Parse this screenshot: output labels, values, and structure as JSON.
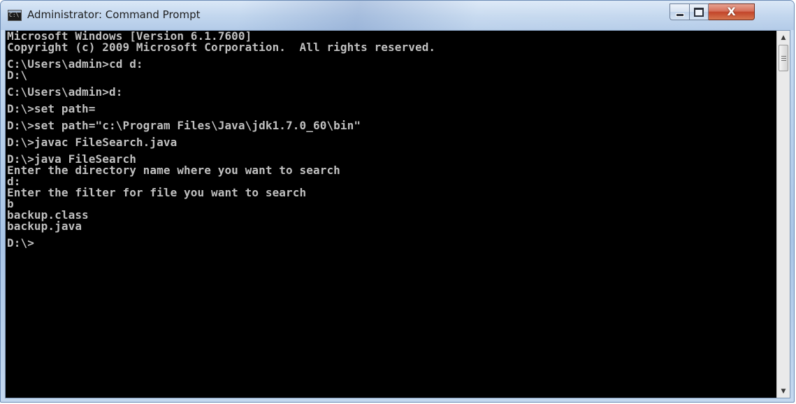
{
  "window": {
    "title": "Administrator: Command Prompt",
    "app_icon_text": "C:\\"
  },
  "controls": {
    "minimize_icon": "minimize-icon",
    "maximize_icon": "maximize-icon",
    "close_icon": "close-icon",
    "close_glyph": "X",
    "close_color": "#c7452a"
  },
  "console": {
    "background_color": "#000000",
    "text_color": "#c0c0c0",
    "lines": [
      "Microsoft Windows [Version 6.1.7600]",
      "Copyright (c) 2009 Microsoft Corporation.  All rights reserved.",
      "",
      "C:\\Users\\admin>cd d:",
      "D:\\",
      "",
      "C:\\Users\\admin>d:",
      "",
      "D:\\>set path=",
      "",
      "D:\\>set path=\"c:\\Program Files\\Java\\jdk1.7.0_60\\bin\"",
      "",
      "D:\\>javac FileSearch.java",
      "",
      "D:\\>java FileSearch",
      "Enter the directory name where you want to search",
      "d:",
      "Enter the filter for file you want to search",
      "b",
      "backup.class",
      "backup.java",
      "",
      "D:\\>"
    ]
  },
  "scrollbar": {
    "up_icon": "scroll-up-arrow-icon",
    "down_icon": "scroll-down-arrow-icon",
    "up_glyph": "▲",
    "down_glyph": "▼"
  }
}
